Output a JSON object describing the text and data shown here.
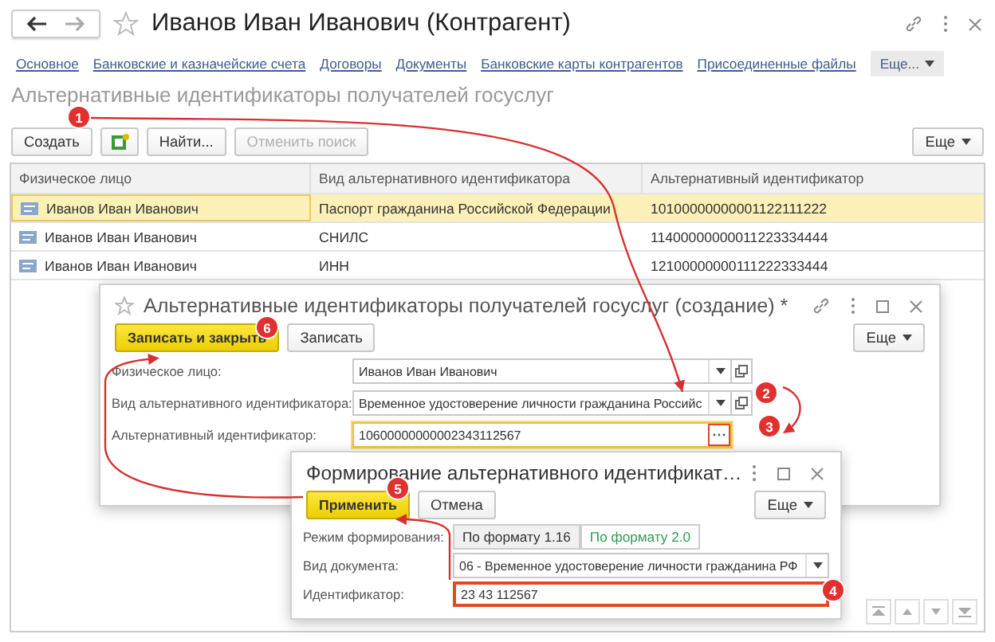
{
  "window": {
    "title": "Иванов Иван Иванович (Контрагент)"
  },
  "nav_links": [
    "Основное",
    "Банковские и казначейские счета",
    "Договоры",
    "Документы",
    "Банковские карты контрагентов",
    "Присоединенные файлы"
  ],
  "nav_more": "Еще...",
  "section_title": "Альтернативные идентификаторы получателей госуслуг",
  "toolbar": [
    {
      "kind": "text",
      "label": "Создать",
      "disabled": false
    },
    {
      "kind": "icon",
      "disabled": false
    },
    {
      "kind": "text",
      "label": "Найти...",
      "disabled": false
    },
    {
      "kind": "text",
      "label": "Отменить поиск",
      "disabled": true
    }
  ],
  "toolbar_more": "Еще",
  "table": {
    "columns": [
      "Физическое лицо",
      "Вид альтернативного идентификатора",
      "Альтернативный идентификатор"
    ],
    "rows": [
      {
        "cells": [
          "Иванов Иван Иванович",
          "Паспорт гражданина Российской Федерации",
          "10100000000001122111222"
        ],
        "selected": true
      },
      {
        "cells": [
          "Иванов Иван Иванович",
          "СНИЛС",
          "11400000000011223334444"
        ],
        "selected": false
      },
      {
        "cells": [
          "Иванов Иван Иванович",
          "ИНН",
          "12100000000111222333444"
        ],
        "selected": false
      }
    ]
  },
  "dialog": {
    "title": "Альтернативные идентификаторы получателей госуслуг (создание) *",
    "buttons": [
      {
        "label": "Записать и закрыть",
        "primary": true
      },
      {
        "label": "Записать",
        "primary": false
      }
    ],
    "more": "Еще",
    "fields": [
      {
        "label": "Физическое лицо:",
        "value": "Иванов Иван Иванович",
        "kind": "select",
        "focused": false
      },
      {
        "label": "Вид альтернативного идентификатора:",
        "value": "Временное удостоверение личности гражданина Российс",
        "kind": "select",
        "focused": false
      },
      {
        "label": "Альтернативный идентификатор:",
        "value": "10600000000002343112567",
        "kind": "choice",
        "focused": true
      }
    ]
  },
  "subdialog": {
    "title": "Формирование альтернативного идентификат…",
    "buttons": [
      {
        "label": "Применить",
        "primary": true
      },
      {
        "label": "Отмена",
        "primary": false
      }
    ],
    "more": "Еще",
    "mode": {
      "label": "Режим формирования:",
      "options": [
        {
          "label": "По формату 1.16",
          "selected": false
        },
        {
          "label": "По формату 2.0",
          "selected": true
        }
      ]
    },
    "fields": [
      {
        "label": "Вид документа:",
        "value": "06 - Временное удостоверение личности гражданина РФ",
        "kind": "dropdown",
        "highlighted": false
      },
      {
        "label": "Идентификатор:",
        "value": "23 43 112567",
        "kind": "input",
        "highlighted": true
      }
    ]
  },
  "steps": [
    "1",
    "2",
    "3",
    "4",
    "5",
    "6"
  ]
}
